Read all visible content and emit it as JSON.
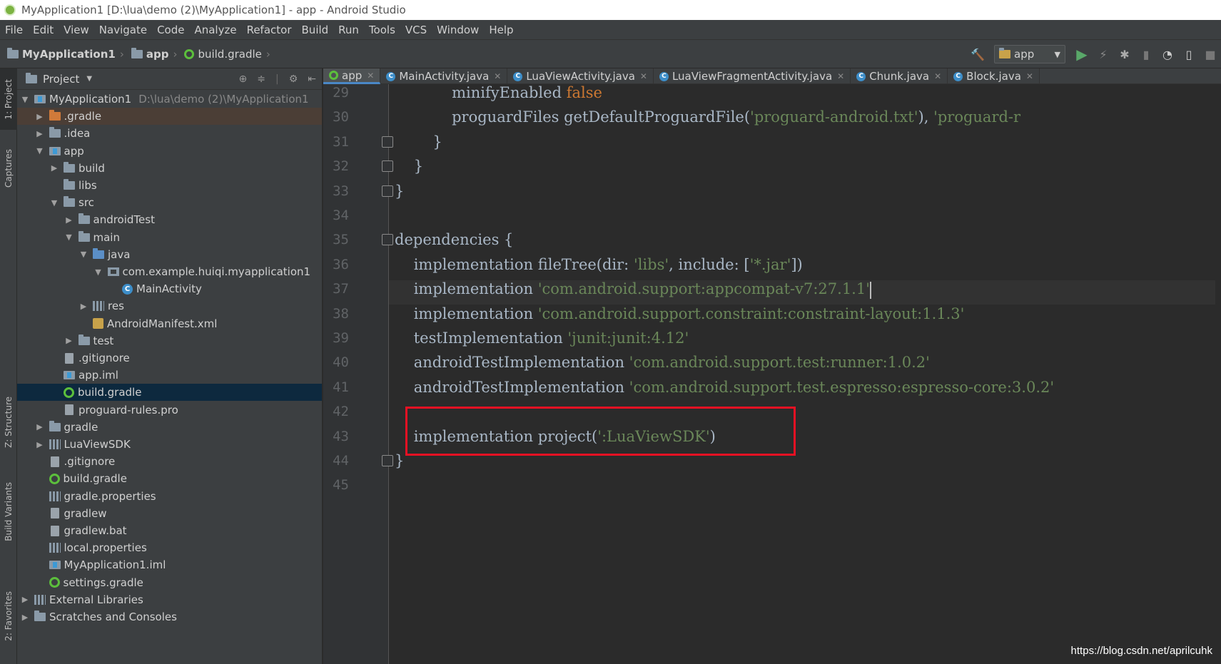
{
  "window": {
    "title": "MyApplication1 [D:\\lua\\demo (2)\\MyApplication1] - app - Android Studio"
  },
  "menu": [
    "File",
    "Edit",
    "View",
    "Navigate",
    "Code",
    "Analyze",
    "Refactor",
    "Build",
    "Run",
    "Tools",
    "VCS",
    "Window",
    "Help"
  ],
  "breadcrumb": [
    "MyApplication1",
    "app",
    "build.gradle"
  ],
  "toolbar": {
    "run_config": "app"
  },
  "left_strip": {
    "project_tab": "1: Project",
    "captures_tab": "Captures",
    "structure_tab": "Z: Structure",
    "build_variants_tab": "Build Variants",
    "favorites_tab": "2: Favorites"
  },
  "project_panel": {
    "title": "Project",
    "root_path": "D:\\lua\\demo (2)\\MyApplication1",
    "tree": [
      {
        "label": "MyApplication1",
        "depth": 0,
        "arrow": "open",
        "icon": "module"
      },
      {
        "label": ".gradle",
        "depth": 1,
        "arrow": "closed",
        "icon": "folder-orange"
      },
      {
        "label": ".idea",
        "depth": 1,
        "arrow": "closed",
        "icon": "folder"
      },
      {
        "label": "app",
        "depth": 1,
        "arrow": "open",
        "icon": "module"
      },
      {
        "label": "build",
        "depth": 2,
        "arrow": "closed",
        "icon": "folder"
      },
      {
        "label": "libs",
        "depth": 2,
        "arrow": "none",
        "icon": "folder"
      },
      {
        "label": "src",
        "depth": 2,
        "arrow": "open",
        "icon": "folder"
      },
      {
        "label": "androidTest",
        "depth": 3,
        "arrow": "closed",
        "icon": "folder"
      },
      {
        "label": "main",
        "depth": 3,
        "arrow": "open",
        "icon": "folder"
      },
      {
        "label": "java",
        "depth": 4,
        "arrow": "open",
        "icon": "folder-blue"
      },
      {
        "label": "com.example.huiqi.myapplication1",
        "depth": 5,
        "arrow": "open",
        "icon": "package"
      },
      {
        "label": "MainActivity",
        "depth": 6,
        "arrow": "none",
        "icon": "class"
      },
      {
        "label": "res",
        "depth": 4,
        "arrow": "closed",
        "icon": "library"
      },
      {
        "label": "AndroidManifest.xml",
        "depth": 4,
        "arrow": "none",
        "icon": "xml"
      },
      {
        "label": "test",
        "depth": 3,
        "arrow": "closed",
        "icon": "folder"
      },
      {
        "label": ".gitignore",
        "depth": 2,
        "arrow": "none",
        "icon": "file"
      },
      {
        "label": "app.iml",
        "depth": 2,
        "arrow": "none",
        "icon": "module"
      },
      {
        "label": "build.gradle",
        "depth": 2,
        "arrow": "none",
        "icon": "gradle",
        "selected": true
      },
      {
        "label": "proguard-rules.pro",
        "depth": 2,
        "arrow": "none",
        "icon": "file"
      },
      {
        "label": "gradle",
        "depth": 1,
        "arrow": "closed",
        "icon": "folder"
      },
      {
        "label": "LuaViewSDK",
        "depth": 1,
        "arrow": "closed",
        "icon": "library"
      },
      {
        "label": ".gitignore",
        "depth": 1,
        "arrow": "none",
        "icon": "file"
      },
      {
        "label": "build.gradle",
        "depth": 1,
        "arrow": "none",
        "icon": "gradle"
      },
      {
        "label": "gradle.properties",
        "depth": 1,
        "arrow": "none",
        "icon": "library"
      },
      {
        "label": "gradlew",
        "depth": 1,
        "arrow": "none",
        "icon": "file"
      },
      {
        "label": "gradlew.bat",
        "depth": 1,
        "arrow": "none",
        "icon": "file"
      },
      {
        "label": "local.properties",
        "depth": 1,
        "arrow": "none",
        "icon": "library"
      },
      {
        "label": "MyApplication1.iml",
        "depth": 1,
        "arrow": "none",
        "icon": "module"
      },
      {
        "label": "settings.gradle",
        "depth": 1,
        "arrow": "none",
        "icon": "gradle"
      },
      {
        "label": "External Libraries",
        "depth": 0,
        "arrow": "closed",
        "icon": "library"
      },
      {
        "label": "Scratches and Consoles",
        "depth": 0,
        "arrow": "closed",
        "icon": "folder"
      }
    ]
  },
  "editor_tabs": [
    {
      "label": "app",
      "icon": "gradle",
      "active": true
    },
    {
      "label": "MainActivity.java",
      "icon": "class"
    },
    {
      "label": "LuaViewActivity.java",
      "icon": "class"
    },
    {
      "label": "LuaViewFragmentActivity.java",
      "icon": "class"
    },
    {
      "label": "Chunk.java",
      "icon": "class"
    },
    {
      "label": "Block.java",
      "icon": "class"
    }
  ],
  "code": [
    {
      "n": "29",
      "indent": "            ",
      "parts": [
        [
          "t",
          "minifyEnabled "
        ],
        [
          "k",
          "false"
        ]
      ]
    },
    {
      "n": "30",
      "indent": "            ",
      "parts": [
        [
          "t",
          "proguardFiles getDefaultProguardFile("
        ],
        [
          "s",
          "'proguard-android.txt'"
        ],
        [
          "t",
          "), "
        ],
        [
          "s",
          "'proguard-r"
        ]
      ]
    },
    {
      "n": "31",
      "indent": "        ",
      "parts": [
        [
          "t",
          "}"
        ]
      ],
      "fold": true
    },
    {
      "n": "32",
      "indent": "    ",
      "parts": [
        [
          "t",
          "}"
        ]
      ],
      "fold": true
    },
    {
      "n": "33",
      "indent": "",
      "parts": [
        [
          "t",
          "}"
        ]
      ],
      "fold": true
    },
    {
      "n": "34",
      "indent": "",
      "parts": []
    },
    {
      "n": "35",
      "indent": "",
      "parts": [
        [
          "t",
          "dependencies {"
        ]
      ],
      "fold": true
    },
    {
      "n": "36",
      "indent": "    ",
      "parts": [
        [
          "t",
          "implementation fileTree(dir: "
        ],
        [
          "s",
          "'libs'"
        ],
        [
          "t",
          ", include: ["
        ],
        [
          "s",
          "'*.jar'"
        ],
        [
          "t",
          "])"
        ]
      ]
    },
    {
      "n": "37",
      "indent": "    ",
      "parts": [
        [
          "t",
          "implementation "
        ],
        [
          "s",
          "'com.android.support:appcompat-v7:27.1.1'"
        ]
      ],
      "current": true
    },
    {
      "n": "38",
      "indent": "    ",
      "parts": [
        [
          "t",
          "implementation "
        ],
        [
          "s",
          "'com.android.support.constraint:constraint-layout:1.1.3'"
        ]
      ]
    },
    {
      "n": "39",
      "indent": "    ",
      "parts": [
        [
          "t",
          "testImplementation "
        ],
        [
          "s",
          "'junit:junit:4.12'"
        ]
      ]
    },
    {
      "n": "40",
      "indent": "    ",
      "parts": [
        [
          "t",
          "androidTestImplementation "
        ],
        [
          "s",
          "'com.android.support.test:runner:1.0.2'"
        ]
      ]
    },
    {
      "n": "41",
      "indent": "    ",
      "parts": [
        [
          "t",
          "androidTestImplementation "
        ],
        [
          "s",
          "'com.android.support.test.espresso:espresso-core:3.0.2'"
        ]
      ]
    },
    {
      "n": "42",
      "indent": "",
      "parts": []
    },
    {
      "n": "43",
      "indent": "    ",
      "parts": [
        [
          "t",
          "implementation project("
        ],
        [
          "s",
          "':LuaViewSDK'"
        ],
        [
          "t",
          ")"
        ]
      ]
    },
    {
      "n": "44",
      "indent": "",
      "parts": [
        [
          "t",
          "}"
        ]
      ],
      "fold": true
    },
    {
      "n": "45",
      "indent": "",
      "parts": []
    }
  ],
  "watermark": "https://blog.csdn.net/aprilcuhk",
  "colors": {
    "keyword": "#cc7832",
    "string": "#6a8759",
    "highlight_box": "#e81123"
  }
}
